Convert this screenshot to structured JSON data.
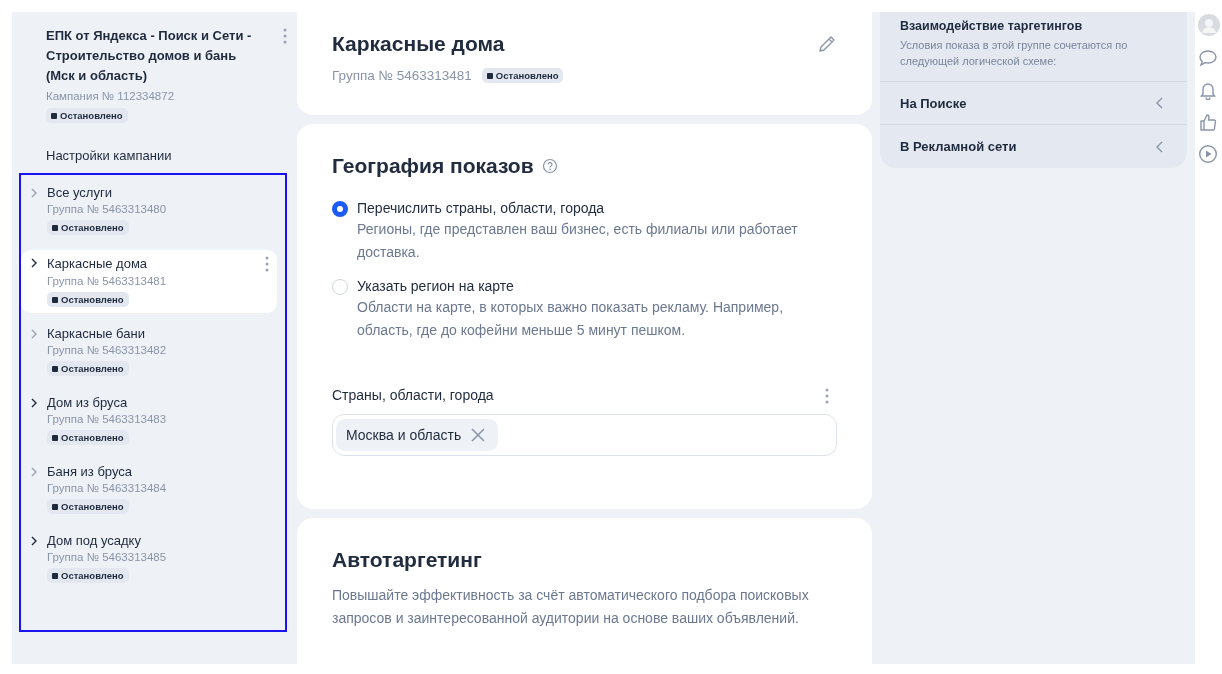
{
  "sidebar": {
    "campaign": {
      "title": "ЕПК от Яндекса - Поиск и Сети - Строительство домов и бань (Мск и область)",
      "number": "Кампания № 112334872",
      "status": "Остановлено"
    },
    "settings_link": "Настройки кампании",
    "groups": [
      {
        "name": "Все услуги",
        "number": "Группа № 5463313480",
        "status": "Остановлено",
        "selected": false,
        "chevron_dark": false
      },
      {
        "name": "Каркасные дома",
        "number": "Группа № 5463313481",
        "status": "Остановлено",
        "selected": true,
        "chevron_dark": true
      },
      {
        "name": "Каркасные бани",
        "number": "Группа № 5463313482",
        "status": "Остановлено",
        "selected": false,
        "chevron_dark": false
      },
      {
        "name": "Дом из бруса",
        "number": "Группа № 5463313483",
        "status": "Остановлено",
        "selected": false,
        "chevron_dark": true
      },
      {
        "name": "Баня из бруса",
        "number": "Группа № 5463313484",
        "status": "Остановлено",
        "selected": false,
        "chevron_dark": false
      },
      {
        "name": "Дом под усадку",
        "number": "Группа № 5463313485",
        "status": "Остановлено",
        "selected": false,
        "chevron_dark": true
      }
    ]
  },
  "header": {
    "title": "Каркасные дома",
    "number": "Группа № 5463313481",
    "status": "Остановлено"
  },
  "geo": {
    "title": "География показов",
    "options": [
      {
        "label": "Перечислить страны, области, города",
        "description": "Регионы, где представлен ваш бизнес, есть филиалы или работает доставка.",
        "selected": true
      },
      {
        "label": "Указать регион на карте",
        "description": "Области на карте, в которых важно показать рекламу. Например, область, где до кофейни меньше 5 минут пешком.",
        "selected": false
      }
    ],
    "field_label": "Страны, области, города",
    "tags": [
      "Москва и область"
    ]
  },
  "autotargeting": {
    "title": "Автотаргетинг",
    "description": "Повышайте эффективность за счёт автоматического подбора поисковых запросов и заинтересованной аудитории на основе ваших объявлений."
  },
  "targeting_panel": {
    "title": "Взаимодействие таргетингов",
    "description": "Условия показа в этой группе сочетаются по следующей логической схеме:",
    "items": [
      {
        "label": "На Поиске",
        "expanded": false
      },
      {
        "label": "В Рекламной сети",
        "expanded": false
      }
    ]
  }
}
